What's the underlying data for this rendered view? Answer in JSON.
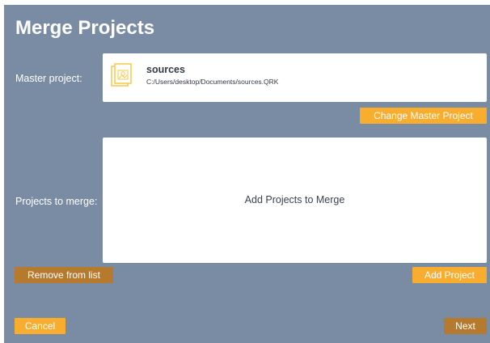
{
  "dialog": {
    "title": "Merge Projects"
  },
  "master": {
    "label": "Master project:",
    "project_name": "sources",
    "project_path": "C:/Users/desktop/Documents/sources.QRK",
    "icon": "project-file-icon",
    "change_button": "Change Master Project"
  },
  "merge": {
    "label": "Projects to merge:",
    "placeholder": "Add Projects to Merge",
    "remove_button": "Remove from list",
    "add_button": "Add Project"
  },
  "footer": {
    "cancel_button": "Cancel",
    "next_button": "Next"
  },
  "colors": {
    "dialog_background": "#7a8ca4",
    "accent_orange": "#f9ad2e",
    "accent_brown": "#b67a2e",
    "icon_yellow": "#f5c84a"
  }
}
